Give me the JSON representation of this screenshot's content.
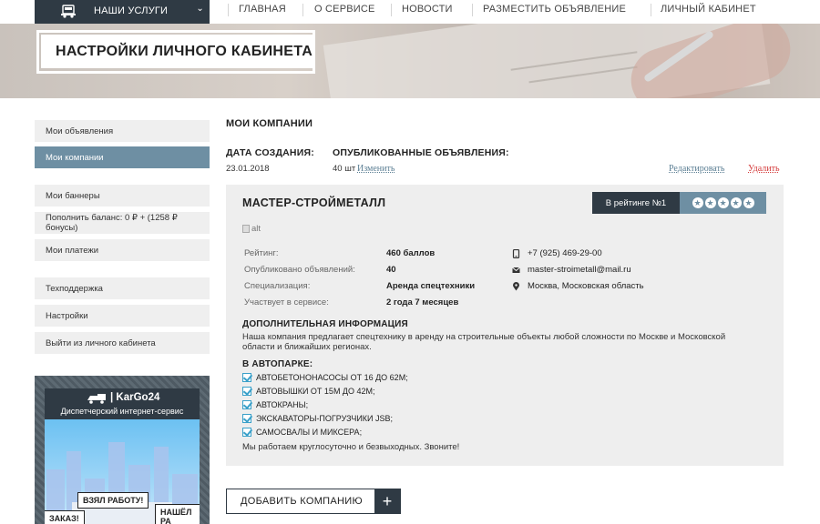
{
  "nav": {
    "services": "НАШИ УСЛУГИ",
    "items": [
      {
        "label": "ГЛАВНАЯ"
      },
      {
        "label": "О СЕРВИСЕ"
      },
      {
        "label": "НОВОСТИ"
      },
      {
        "label": "РАЗМЕСТИТЬ ОБЪЯВЛЕНИЕ"
      },
      {
        "label": "ЛИЧНЫЙ КАБИНЕТ"
      }
    ]
  },
  "hero": {
    "title": "НАСТРОЙКИ ЛИЧНОГО КАБИНЕТА"
  },
  "sidebar": {
    "items": [
      {
        "label": "Мои объявления"
      },
      {
        "label": "Мои компании",
        "active": true
      },
      {
        "label": "Мои баннеры"
      },
      {
        "label": "Пополнить баланс: 0 ₽ + (1258 ₽ бонусы)"
      },
      {
        "label": "Мои платежи"
      },
      {
        "label": "Техподдержка"
      },
      {
        "label": "Настройки"
      },
      {
        "label": "Выйти из личного кабинета"
      }
    ]
  },
  "ad": {
    "brand": "KarGo24",
    "subtitle": "Диспетчерский интернет-сервис",
    "badge_left": "ВЗЯЛ РАБОТУ!",
    "badge_right": "НАШЁЛ РА",
    "badge_bottom": "ЗАКАЗ!"
  },
  "main": {
    "section_title": "МОИ КОМПАНИИ",
    "created_label": "ДАТА СОЗДАНИЯ:",
    "created_value": "23.01.2018",
    "published_label": "ОПУБЛИКОВАННЫЕ ОБЪЯВЛЕНИЯ:",
    "published_value": "40 шт",
    "change_link": "Изменить",
    "edit_link": "Редактировать",
    "delete_link": "Удалить"
  },
  "company": {
    "name": "МАСТЕР-СТРОЙМЕТАЛЛ",
    "rating_label": "В рейтинге №1",
    "stars": 5,
    "image_alt": "alt",
    "details": [
      {
        "key": "Рейтинг:",
        "value": "460 баллов"
      },
      {
        "key": "Опубликовано объявлений:",
        "value": "40"
      },
      {
        "key": "Специализация:",
        "value": "Аренда спецтехники"
      },
      {
        "key": "Участвует в сервисе:",
        "value": "2 года 7 месяцев"
      }
    ],
    "phone": "+7 (925) 469-29-00",
    "email": "master-stroimetall@mail.ru",
    "location": "Москва, Московская область",
    "extra_title": "ДОПОЛНИТЕЛЬНАЯ ИНФОРМАЦИЯ",
    "extra_text": "Наша компания предлагает спецтехнику в аренду на строительные объекты любой сложности по Москве и Московской области и ближайших регионах.",
    "fleet_title": "В АВТОПАРКЕ:",
    "fleet": [
      "АВТОБЕТОНОНАСОСЫ ОТ 16 ДО 62М;",
      "АВТОВЫШКИ ОТ 15М ДО 42М;",
      "АВТОКРАНЫ;",
      "ЭКСКАВАТОРЫ-ПОГРУЗЧИКИ JSB;",
      "САМОСВАЛЫ И МИКСЕРА;"
    ],
    "closing": "Мы работаем круглосуточно и безвыходных. Звоните!"
  },
  "add_button": {
    "label": "ДОБАВИТЬ КОМПАНИЮ",
    "icon": "+"
  },
  "colors": {
    "dark": "#2f3a44",
    "accent": "#6e8fa3",
    "danger": "#d43b3b",
    "check": "#3aa0c9"
  }
}
